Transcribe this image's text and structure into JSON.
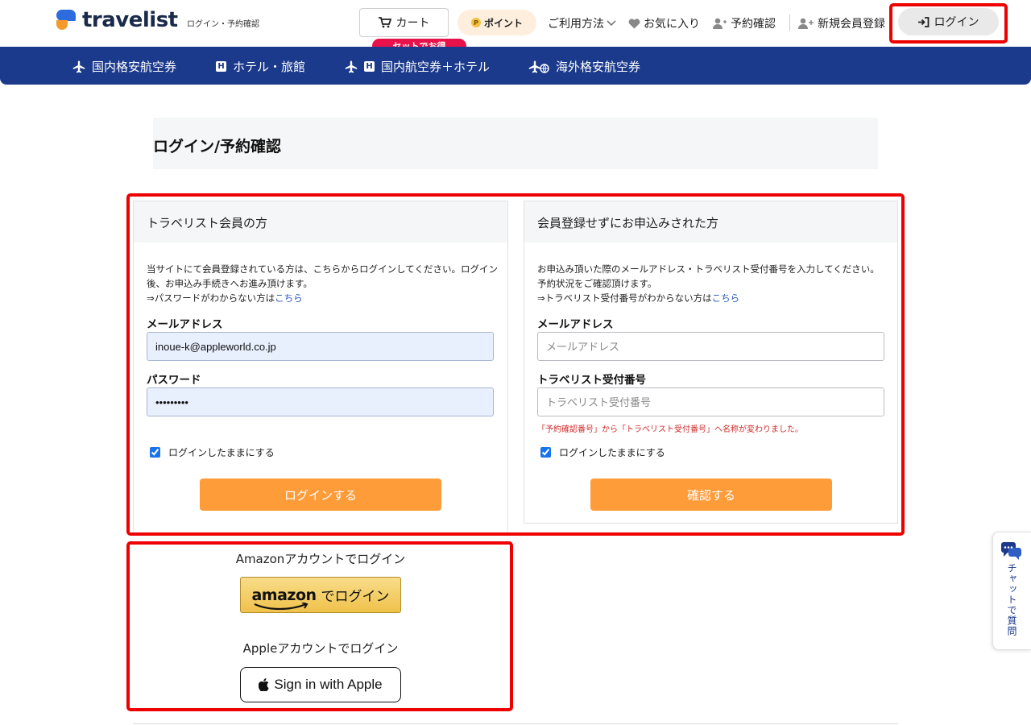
{
  "header": {
    "logo_text": "travelist",
    "logo_sub": "ログイン・予約確認",
    "cart_label": "カート",
    "set_badge": "セットでお得",
    "point_label": "ポイント",
    "point_coin": "P",
    "usage_label": "ご利用方法",
    "favorites_label": "お気に入り",
    "reservation_label": "予約確認",
    "signup_label": "新規会員登録",
    "login_label": "ログイン"
  },
  "nav": {
    "domestic_flights": "国内格安航空券",
    "hotels": "ホテル・旅館",
    "flight_hotel": "国内航空券＋ホテル",
    "overseas_flights": "海外格安航空券",
    "hotel_glyph": "H"
  },
  "page": {
    "title": "ログイン/予約確認"
  },
  "member": {
    "heading": "トラベリスト会員の方",
    "desc_line1": "当サイトにて会員登録されている方は、こちらからログインしてください。ログイン後、お申込み手続きへお進み頂けます。",
    "desc_forgot": "⇒パスワードがわからない方は",
    "desc_link": "こちら",
    "email_label": "メールアドレス",
    "email_value": "inoue-k@appleworld.co.jp",
    "password_label": "パスワード",
    "password_value": "•••••••••",
    "remember_label": "ログインしたままにする",
    "submit_label": "ログインする"
  },
  "guest": {
    "heading": "会員登録せずにお申込みされた方",
    "desc_line1": "お申込み頂いた際のメールアドレス・トラベリスト受付番号を入力してください。予約状況をご確認頂けます。",
    "desc_forgot": "⇒トラベリスト受付番号がわからない方は",
    "desc_link": "こちら",
    "email_label": "メールアドレス",
    "email_placeholder": "メールアドレス",
    "number_label": "トラベリスト受付番号",
    "number_placeholder": "トラベリスト受付番号",
    "rename_note": "「予約確認番号」から「トラベリスト受付番号」へ名称が変わりました。",
    "remember_label": "ログインしたままにする",
    "submit_label": "確認する"
  },
  "social": {
    "amazon_title": "Amazonアカウントでログイン",
    "amazon_word": "amazon",
    "amazon_suffix": "でログイン",
    "apple_title": "Appleアカウントでログイン",
    "apple_label": "Sign in with Apple"
  },
  "chat": {
    "label": "チャットで質問"
  },
  "colors": {
    "brand_blue": "#1b3a8c",
    "accent_orange": "#fe9c3a",
    "annotation_red": "#ee0000",
    "badge_red": "#e8124a"
  }
}
